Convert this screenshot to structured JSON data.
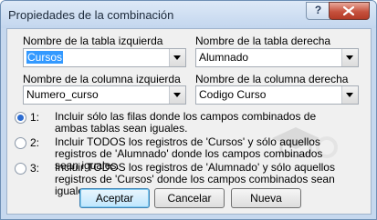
{
  "window": {
    "title": "Propiedades de la combinación"
  },
  "controls": {
    "help_glyph": "?",
    "close_icon": "close-icon"
  },
  "left_table": {
    "label": "Nombre de la tabla izquierda",
    "value": "Cursos"
  },
  "right_table": {
    "label": "Nombre de la tabla derecha",
    "value": "Alumnado"
  },
  "left_column": {
    "label": "Nombre de la columna izquierda",
    "value": "Numero_curso"
  },
  "right_column": {
    "label": "Nombre de la columna derecha",
    "value": "Codigo Curso"
  },
  "options": [
    {
      "number": "1:",
      "text": "Incluir sólo las filas donde los campos combinados de ambas tablas sean iguales.",
      "selected": true
    },
    {
      "number": "2:",
      "text": "Incluir TODOS los registros de 'Cursos' y sólo aquellos registros de 'Alumnado' donde los campos combinados sean iguales.",
      "selected": false
    },
    {
      "number": "3:",
      "text": "Incluir TODOS los registros de 'Alumnado' y sólo aquellos registros de 'Cursos' donde los campos combinados sean iguales.",
      "selected": false
    }
  ],
  "buttons": {
    "accept": "Aceptar",
    "cancel": "Cancelar",
    "new": "Nueva"
  }
}
